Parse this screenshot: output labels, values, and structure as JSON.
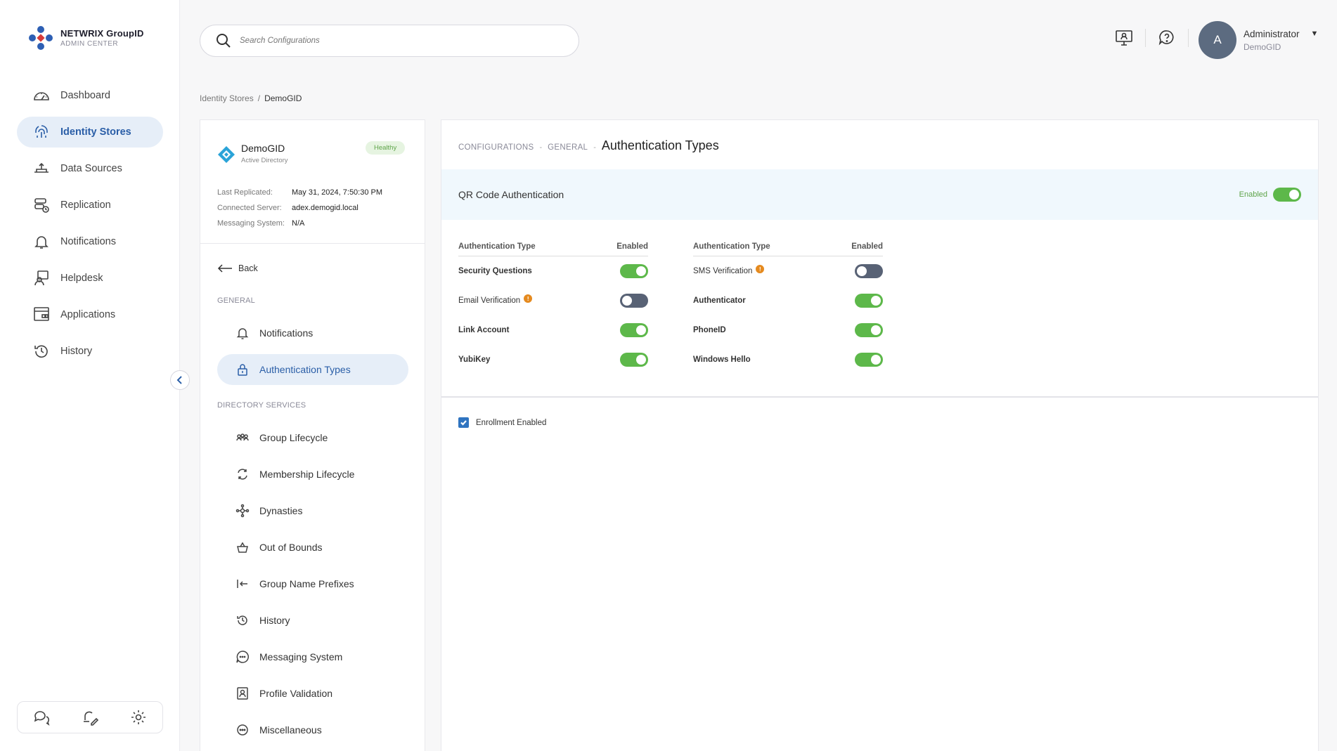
{
  "brand": {
    "title": "NETWRIX GroupID",
    "subtitle": "ADMIN CENTER"
  },
  "nav": [
    {
      "label": "Dashboard",
      "icon": "dashboard-icon"
    },
    {
      "label": "Identity Stores",
      "icon": "identity-stores-icon",
      "active": true
    },
    {
      "label": "Data Sources",
      "icon": "data-sources-icon"
    },
    {
      "label": "Replication",
      "icon": "replication-icon"
    },
    {
      "label": "Notifications",
      "icon": "bell-icon"
    },
    {
      "label": "Helpdesk",
      "icon": "helpdesk-icon"
    },
    {
      "label": "Applications",
      "icon": "applications-icon"
    },
    {
      "label": "History",
      "icon": "history-icon"
    }
  ],
  "search": {
    "placeholder": "Search Configurations"
  },
  "user": {
    "initial": "A",
    "name": "Administrator",
    "org": "DemoGID"
  },
  "breadcrumb": {
    "parent": "Identity Stores",
    "separator": "/",
    "current": "DemoGID"
  },
  "store": {
    "name": "DemoGID",
    "type": "Active Directory",
    "status": "Healthy",
    "meta": [
      {
        "key": "Last Replicated:",
        "value": "May 31, 2024, 7:50:30 PM"
      },
      {
        "key": "Connected Server:",
        "value": "adex.demogid.local"
      },
      {
        "key": "Messaging System:",
        "value": "N/A"
      }
    ]
  },
  "subnav": {
    "back_label": "Back",
    "general_label": "GENERAL",
    "general_items": [
      {
        "label": "Notifications"
      },
      {
        "label": "Authentication Types",
        "active": true
      }
    ],
    "directory_label": "DIRECTORY SERVICES",
    "directory_items": [
      {
        "label": "Group Lifecycle"
      },
      {
        "label": "Membership Lifecycle"
      },
      {
        "label": "Dynasties"
      },
      {
        "label": "Out of Bounds"
      },
      {
        "label": "Group Name Prefixes"
      },
      {
        "label": "History"
      },
      {
        "label": "Messaging System"
      },
      {
        "label": "Profile Validation"
      },
      {
        "label": "Miscellaneous"
      }
    ]
  },
  "main": {
    "crumb1": "CONFIGURATIONS",
    "crumb2": "GENERAL",
    "sep": "-",
    "title": "Authentication Types",
    "qr": {
      "label": "QR Code Authentication",
      "status_label": "Enabled",
      "enabled": true
    },
    "col_header_type": "Authentication Type",
    "col_header_enabled": "Enabled",
    "left_types": [
      {
        "label": "Security Questions",
        "enabled": true,
        "bold": true
      },
      {
        "label": "Email Verification",
        "enabled": false,
        "bold": false,
        "info": true
      },
      {
        "label": "Link Account",
        "enabled": true,
        "bold": true
      },
      {
        "label": "YubiKey",
        "enabled": true,
        "bold": true
      }
    ],
    "right_types": [
      {
        "label": "SMS Verification",
        "enabled": false,
        "bold": false,
        "info": true
      },
      {
        "label": "Authenticator",
        "enabled": true,
        "bold": true
      },
      {
        "label": "PhoneID",
        "enabled": true,
        "bold": true
      },
      {
        "label": "Windows Hello",
        "enabled": true,
        "bold": true
      }
    ],
    "enrollment_label": "Enrollment Enabled",
    "info_glyph": "!"
  },
  "colors": {
    "accent": "#2a5ea7",
    "toggle_on": "#5db84a",
    "toggle_off": "#586275",
    "info": "#e58a1f"
  }
}
